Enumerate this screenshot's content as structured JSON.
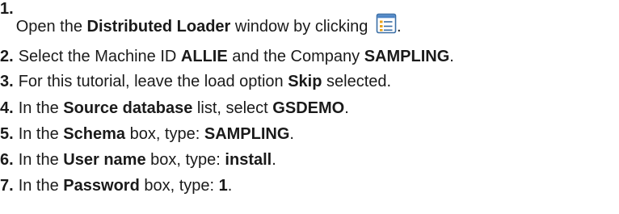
{
  "steps": [
    {
      "number": "1.",
      "parts": [
        "Open the ",
        "Distributed Loader",
        " window by clicking ",
        "."
      ],
      "icon": "distributed-loader-icon"
    },
    {
      "number": "2.",
      "parts": [
        "Select the Machine ID ",
        "ALLIE",
        " and the Company ",
        "SAMPLING",
        "."
      ]
    },
    {
      "number": "3.",
      "parts": [
        "For this tutorial, leave the load option ",
        "Skip",
        " selected."
      ]
    },
    {
      "number": "4.",
      "parts": [
        "In the ",
        "Source database",
        " list, select ",
        "GSDEMO",
        "."
      ]
    },
    {
      "number": "5.",
      "parts": [
        "In the ",
        "Schema",
        " box, type: ",
        "SAMPLING",
        "."
      ]
    },
    {
      "number": "6.",
      "parts": [
        "In the ",
        "User name",
        " box, type: ",
        "install",
        "."
      ]
    },
    {
      "number": "7.",
      "parts": [
        "In the ",
        "Password",
        " box, type: ",
        "1",
        "."
      ]
    }
  ],
  "colors": {
    "icon_border": "#3a6ea5",
    "icon_header": "#4f86c6",
    "icon_bullet": "#e8a21a",
    "icon_line": "#3a6ea5"
  }
}
